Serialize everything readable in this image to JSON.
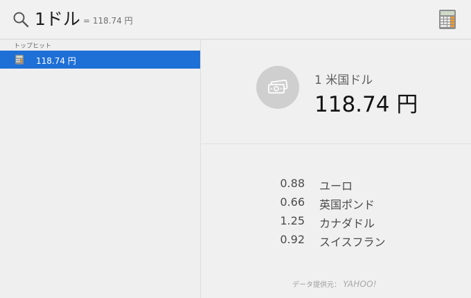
{
  "search": {
    "query": "1ドル",
    "hint": "= 118.74 円",
    "icon": "magnifying-glass-icon",
    "app_icon": "calculator-icon"
  },
  "sidebar": {
    "section_header": "トップヒット",
    "items": [
      {
        "label": "118.74 円",
        "icon": "calculator-icon",
        "selected": true
      }
    ],
    "selection_color": "#1e6fd6"
  },
  "preview": {
    "icon": "banknote-icon",
    "unit_label": "1 米国ドル",
    "value": "118.74 円",
    "rates": [
      {
        "value": "0.88",
        "name": "ユーロ"
      },
      {
        "value": "0.66",
        "name": "英国ポンド"
      },
      {
        "value": "1.25",
        "name": "カナダドル"
      },
      {
        "value": "0.92",
        "name": "スイスフラン"
      }
    ],
    "provider_prefix": "データ提供元：",
    "provider_name": "YAHOO!"
  }
}
